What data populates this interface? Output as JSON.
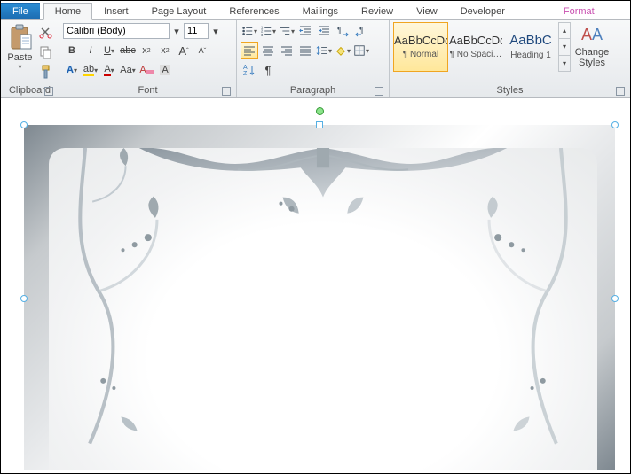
{
  "tabs": {
    "file": "File",
    "items": [
      "Home",
      "Insert",
      "Page Layout",
      "References",
      "Mailings",
      "Review",
      "View",
      "Developer"
    ],
    "format": "Format",
    "active": "Home"
  },
  "clipboard": {
    "label": "Clipboard",
    "paste": "Paste"
  },
  "font": {
    "label": "Font",
    "name": "Calibri (Body)",
    "size": "11"
  },
  "paragraph": {
    "label": "Paragraph"
  },
  "styles": {
    "label": "Styles",
    "sample": "AaBbCcDc",
    "sample_heading": "AaBbC",
    "items": [
      {
        "name": "¶ Normal",
        "selected": true
      },
      {
        "name": "¶ No Spaci…",
        "selected": false
      },
      {
        "name": "Heading 1",
        "selected": false
      }
    ],
    "change": "Change\nStyles"
  }
}
